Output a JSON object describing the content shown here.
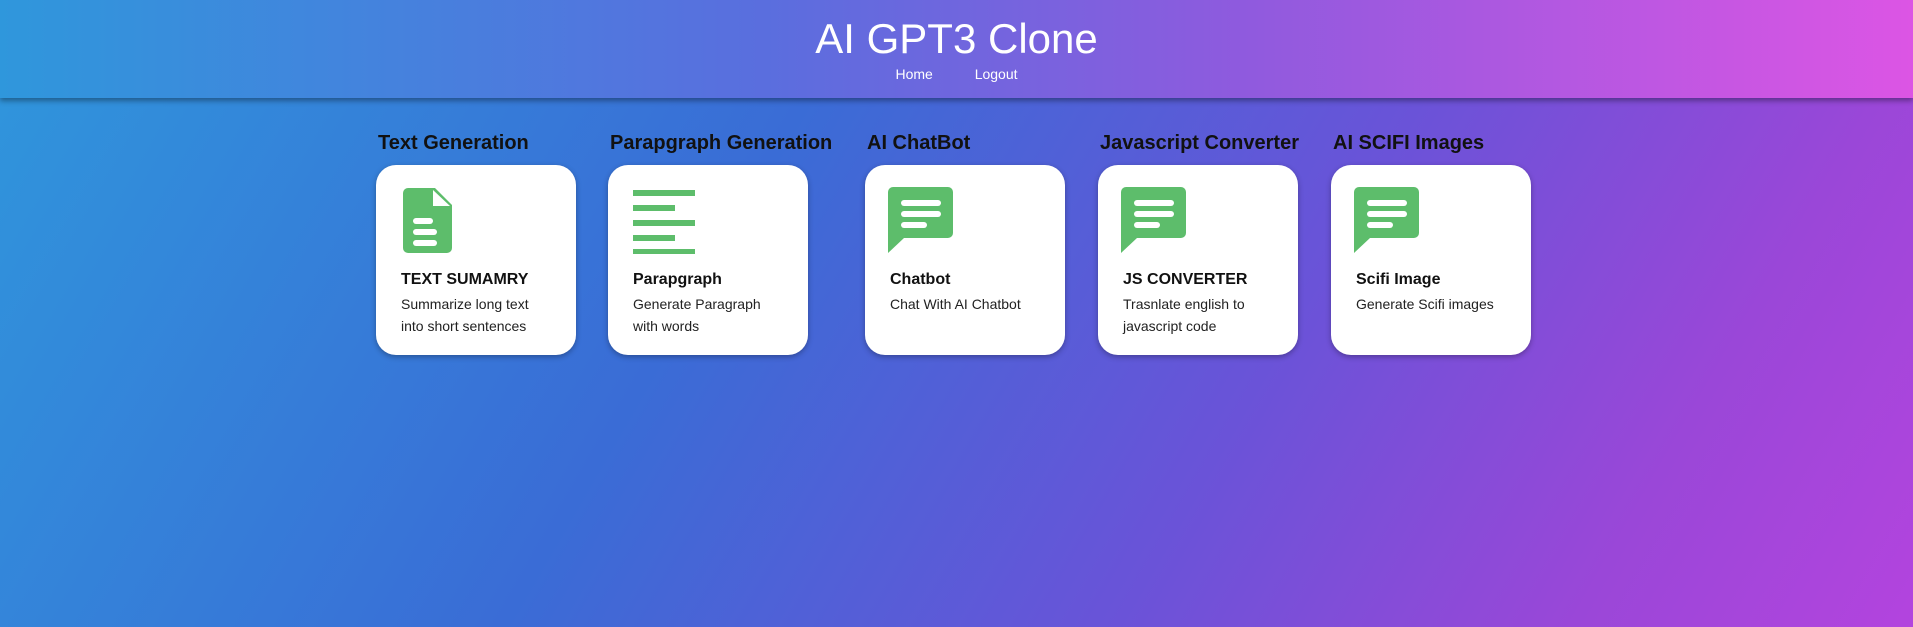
{
  "header": {
    "title": "AI GPT3 Clone",
    "nav": [
      {
        "label": "Home"
      },
      {
        "label": "Logout"
      }
    ]
  },
  "colors": {
    "icon_green": "#5dbd6b",
    "card_bg": "#ffffff"
  },
  "sections": [
    {
      "heading": "Text Generation",
      "card": {
        "icon": "document-icon",
        "title": "TEXT SUMAMRY",
        "description": "Summarize long text into short sentences"
      }
    },
    {
      "heading": "Parapgraph Generation",
      "card": {
        "icon": "paragraph-lines-icon",
        "title": "Parapgraph",
        "description": "Generate Paragraph with words"
      }
    },
    {
      "heading": "AI ChatBot",
      "card": {
        "icon": "chat-bubble-icon",
        "title": "Chatbot",
        "description": "Chat With AI Chatbot"
      }
    },
    {
      "heading": "Javascript Converter",
      "card": {
        "icon": "chat-bubble-icon",
        "title": "JS CONVERTER",
        "description": "Trasnlate english to javascript code"
      }
    },
    {
      "heading": "AI SCIFI Images",
      "card": {
        "icon": "chat-bubble-icon",
        "title": "Scifi Image",
        "description": "Generate Scifi images"
      }
    }
  ]
}
